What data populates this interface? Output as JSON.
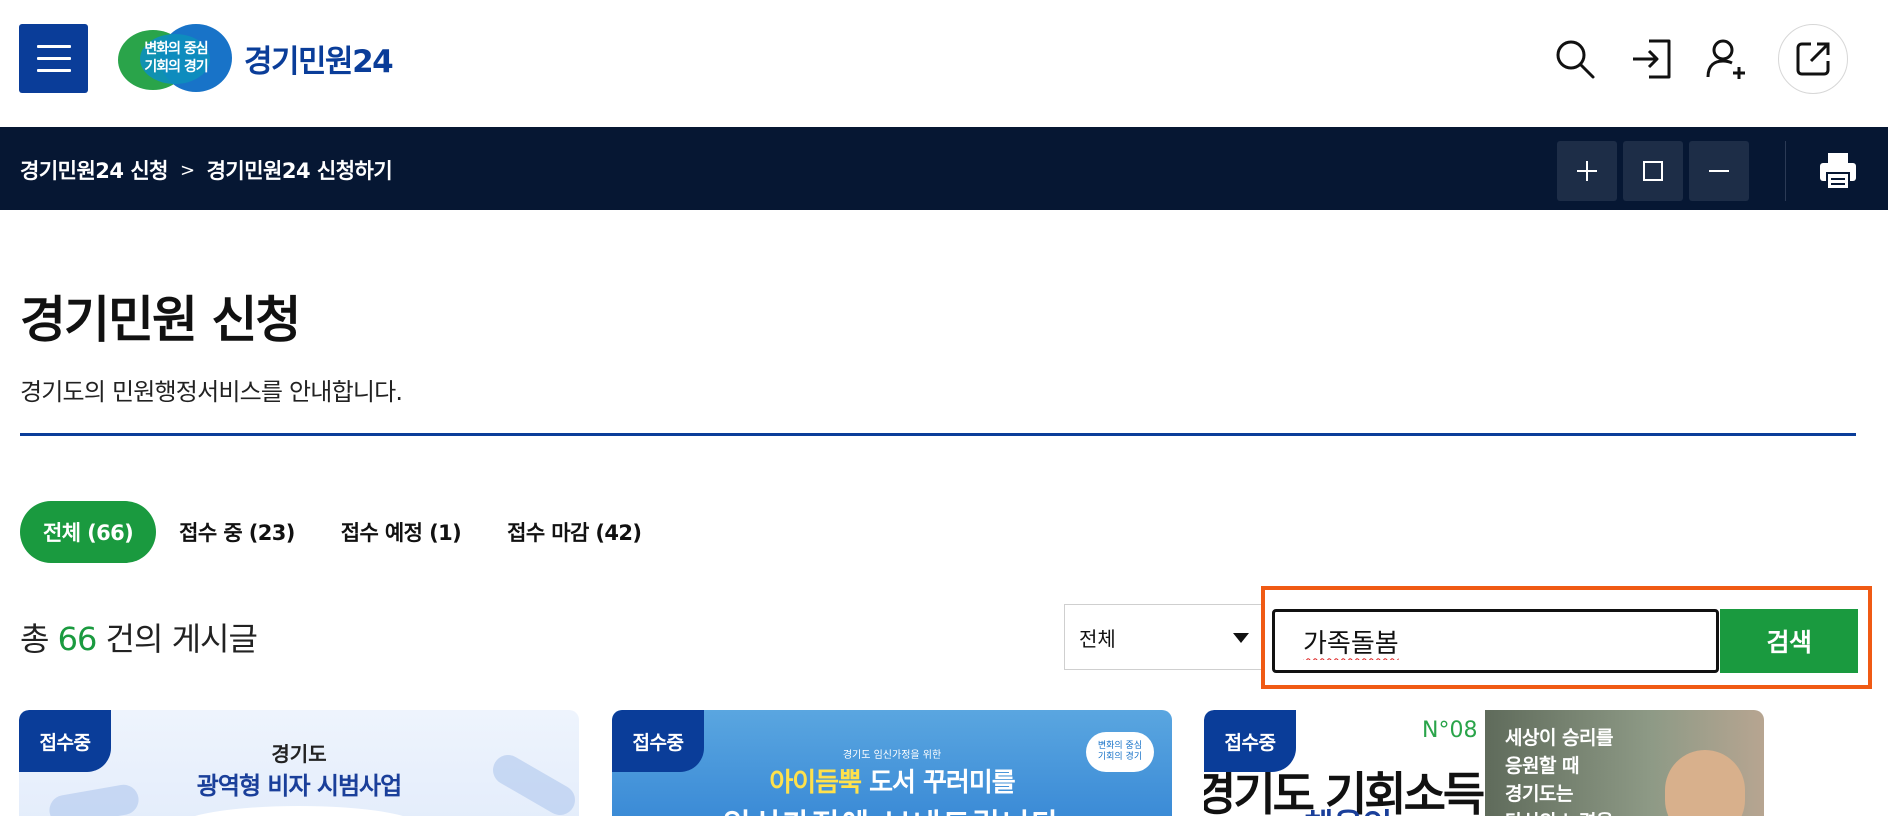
{
  "header": {
    "logo_badge_line1": "변화의 중심",
    "logo_badge_line2": "기회의 경기",
    "logo_name": "경기민원24",
    "icons": [
      "menu-icon",
      "search-icon",
      "login-icon",
      "join-icon",
      "external-link-icon"
    ]
  },
  "breadcrumb": {
    "items": [
      "경기민원24 신청",
      "경기민원24 신청하기"
    ],
    "separator": ">",
    "zoom_in": "+",
    "zoom_reset": "□",
    "zoom_out": "−"
  },
  "page": {
    "title": "경기민원 신청",
    "description": "경기도의 민원행정서비스를 안내합니다."
  },
  "tabs": [
    {
      "label": "전체 (66)",
      "active": true
    },
    {
      "label": "접수 중 (23)",
      "active": false
    },
    {
      "label": "접수 예정 (1)",
      "active": false
    },
    {
      "label": "접수 마감 (42)",
      "active": false
    }
  ],
  "results": {
    "prefix": "총 ",
    "count": "66",
    "suffix": " 건의 게시글"
  },
  "search": {
    "select_value": "전체",
    "query": "가족돌봄",
    "button_label": "검색"
  },
  "cards": [
    {
      "badge": "접수중",
      "subtitle": "경기도",
      "title": "광역형 비자 시범사업"
    },
    {
      "badge": "접수중",
      "mini": "경기도 임신가정을 위한",
      "title_hl": "아이듬뿍",
      "title_rest": " 도서 꾸러미를",
      "bottom": "임신가정에 보내드립니다",
      "cloud_line1": "변화의 중심",
      "cloud_line2": "기회의 경기"
    },
    {
      "badge": "접수중",
      "number": "N°08",
      "big": "경기도 기회소득",
      "big2": "체육인",
      "photo_text": [
        "세상이 승리를",
        "응원할 때",
        "경기도는",
        "당신의 노력을"
      ]
    }
  ],
  "colors": {
    "primary_blue": "#0a3d99",
    "dark_navy": "#061733",
    "green": "#1a9a3f",
    "highlight_orange": "#f05a14"
  }
}
